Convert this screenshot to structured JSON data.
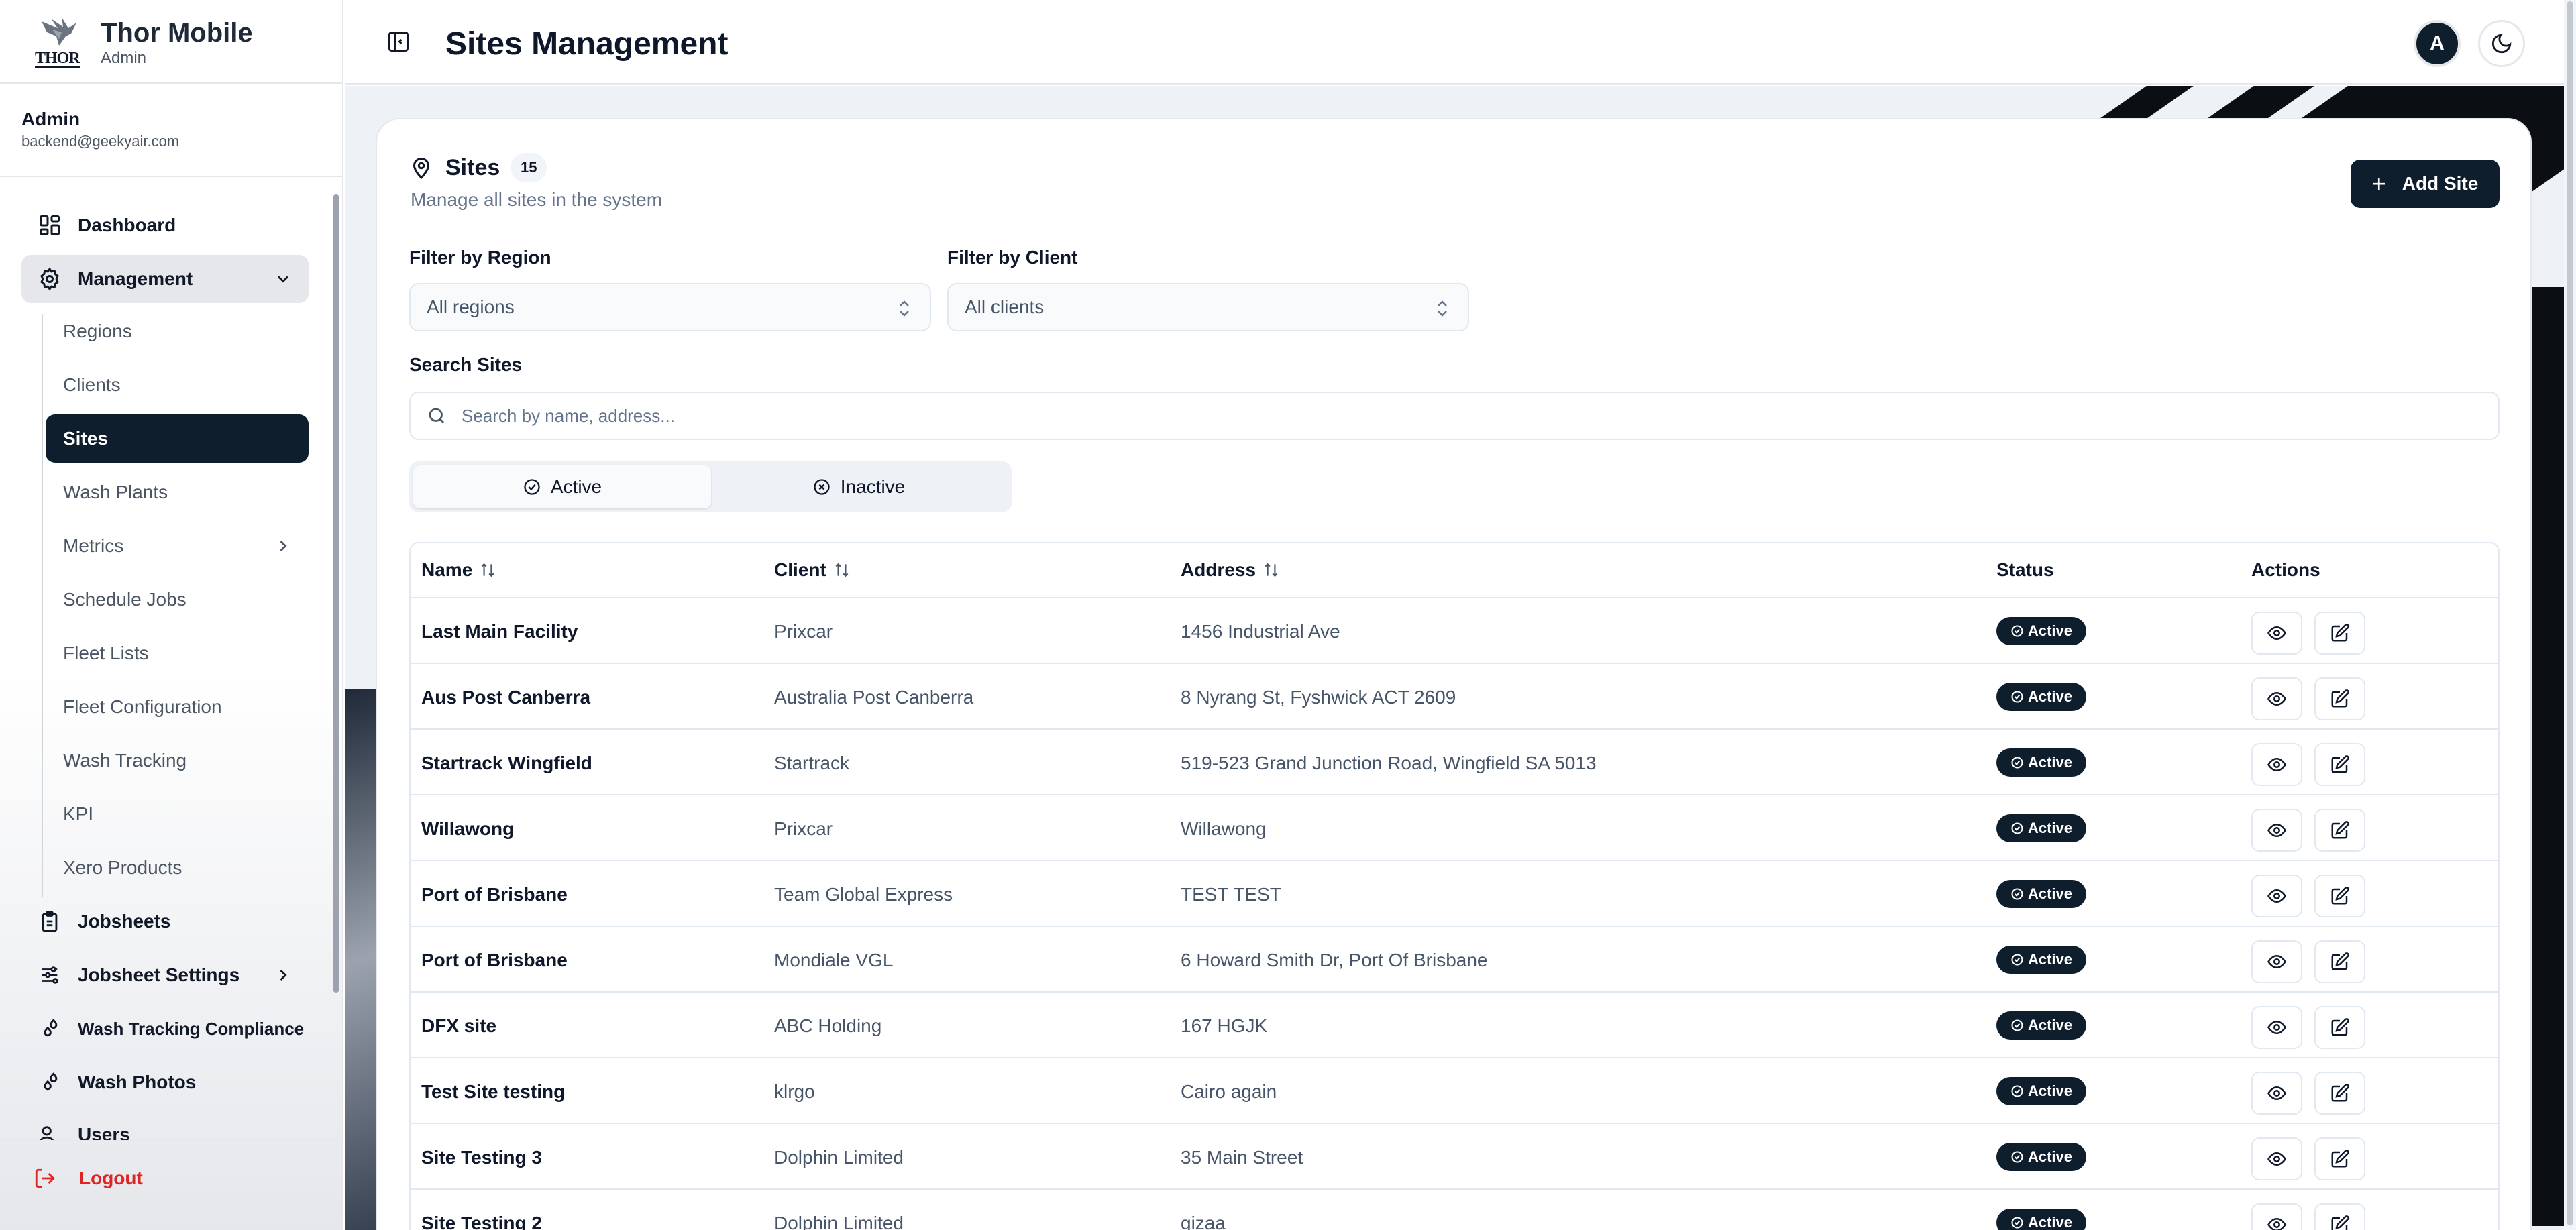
{
  "brand": {
    "title": "Thor Mobile",
    "subtitle": "Admin",
    "logo_word": "THOR"
  },
  "user": {
    "name": "Admin",
    "email": "backend@geekyair.com"
  },
  "nav": {
    "dashboard": "Dashboard",
    "management": "Management",
    "sub": [
      "Regions",
      "Clients",
      "Sites",
      "Wash Plants",
      "Metrics",
      "Schedule Jobs",
      "Fleet Lists",
      "Fleet Configuration",
      "Wash Tracking",
      "KPI",
      "Xero Products"
    ],
    "jobsheets": "Jobsheets",
    "jobsheet_settings": "Jobsheet Settings",
    "wash_tracking_compliance": "Wash Tracking Compliance",
    "wash_photos": "Wash Photos",
    "users": "Users",
    "logout": "Logout"
  },
  "topbar": {
    "title": "Sites Management",
    "avatar_initial": "A"
  },
  "sites": {
    "title": "Sites",
    "count": "15",
    "subtitle": "Manage all sites in the system",
    "add_label": "Add Site"
  },
  "filters": {
    "region_label": "Filter by Region",
    "region_value": "All regions",
    "client_label": "Filter by Client",
    "client_value": "All clients",
    "search_label": "Search Sites",
    "search_placeholder": "Search by name, address..."
  },
  "segment": {
    "active": "Active",
    "inactive": "Inactive"
  },
  "table": {
    "headers": {
      "name": "Name",
      "client": "Client",
      "address": "Address",
      "status": "Status",
      "actions": "Actions"
    },
    "rows": [
      {
        "name": "Last Main Facility",
        "client": "Prixcar",
        "address": "1456 Industrial Ave",
        "status": "Active"
      },
      {
        "name": "Aus Post Canberra",
        "client": "Australia Post Canberra",
        "address": "8 Nyrang St, Fyshwick ACT 2609",
        "status": "Active"
      },
      {
        "name": "Startrack Wingfield",
        "client": "Startrack",
        "address": "519-523 Grand Junction Road, Wingfield SA 5013",
        "status": "Active"
      },
      {
        "name": "Willawong",
        "client": "Prixcar",
        "address": "Willawong",
        "status": "Active"
      },
      {
        "name": "Port of Brisbane",
        "client": "Team Global Express",
        "address": "TEST TEST",
        "status": "Active"
      },
      {
        "name": "Port of Brisbane",
        "client": "Mondiale VGL",
        "address": "6 Howard Smith Dr, Port Of Brisbane",
        "status": "Active"
      },
      {
        "name": "DFX site",
        "client": "ABC Holding",
        "address": "167 HGJK",
        "status": "Active"
      },
      {
        "name": "Test Site testing",
        "client": "klrgo",
        "address": "Cairo again",
        "status": "Active"
      },
      {
        "name": "Site Testing 3",
        "client": "Dolphin Limited",
        "address": "35 Main Street",
        "status": "Active"
      },
      {
        "name": "Site Testing 2",
        "client": "Dolphin Limited",
        "address": "gizaa",
        "status": "Active"
      }
    ]
  },
  "colors": {
    "primary": "#0f1e2c",
    "danger": "#dc2626",
    "border": "#e2e8f0"
  }
}
